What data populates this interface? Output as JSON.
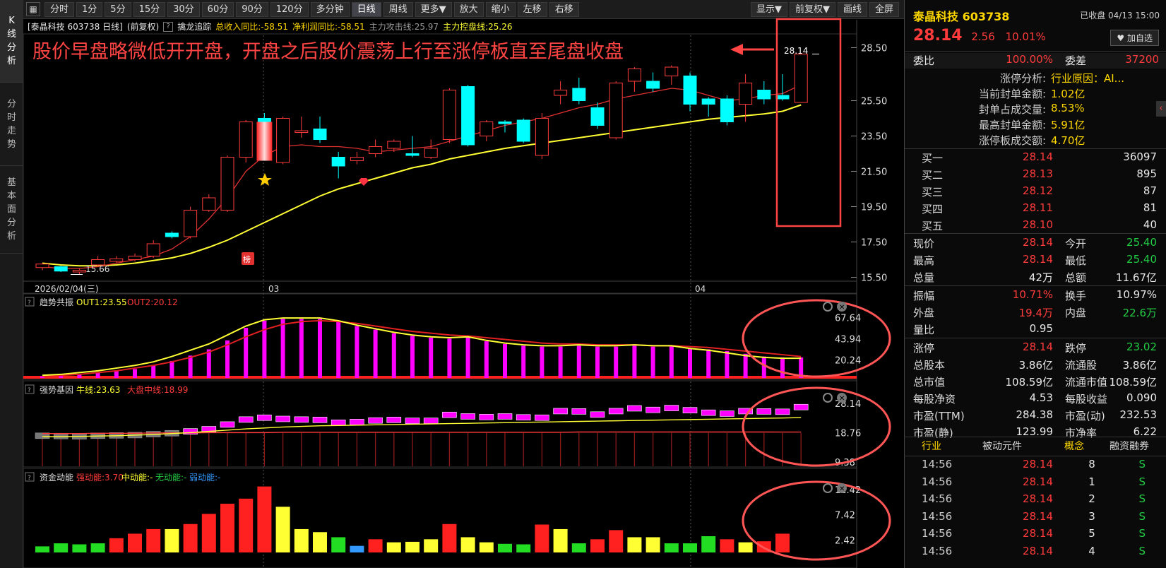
{
  "tabs": {
    "kline": [
      "K",
      "线",
      "分",
      "析"
    ],
    "timeshare": [
      "分",
      "时",
      "走",
      "势"
    ],
    "fundamental": [
      "基",
      "本",
      "面",
      "分",
      "析"
    ]
  },
  "toolbar": {
    "periods": [
      "分时",
      "1分",
      "5分",
      "15分",
      "30分",
      "60分",
      "90分",
      "120分",
      "多分钟",
      "日线",
      "周线",
      "更多▼",
      "放大",
      "缩小",
      "左移",
      "右移"
    ],
    "active_period": "日线",
    "right": [
      "显示▼",
      "前复权▼",
      "画线",
      "全屏"
    ]
  },
  "chart_info": {
    "stock": "[泰晶科技 603738 日线]",
    "adjust": "(前复权)",
    "indicator": "擒龙追踪",
    "revenue": "总收入同比:-58.51",
    "profit": "净利润同比:-58.51",
    "attack": "主力攻击线:25.97",
    "control": "主力控盘线:25.26"
  },
  "annotation": "股价早盘略微低开开盘，开盘之后股价震荡上行至涨停板直至尾盘收盘",
  "price_axis": [
    "28.50",
    "25.50",
    "23.50",
    "21.50",
    "19.50",
    "17.50",
    "15.50"
  ],
  "date_axis": {
    "start": "2026/02/04(三)",
    "m1": "03",
    "m2": "04"
  },
  "labels": {
    "low": "15.66",
    "last": "28.14",
    "bang": "榜"
  },
  "panel1": {
    "name": "趋势共振",
    "out1": "OUT1:23.55",
    "out2": "OUT2:20.12",
    "axis": [
      "67.64",
      "43.94",
      "20.24"
    ]
  },
  "panel2": {
    "name": "强势基因",
    "bull": "牛线:23.63",
    "market": "大盘中线:18.99",
    "axis": [
      "28.14",
      "18.76",
      "9.38"
    ]
  },
  "panel3": {
    "name": "资金动能",
    "strong": "强动能:3.70",
    "mid": "中动能:-",
    "none": "无动能:-",
    "weak": "弱动能:-",
    "axis": [
      "12.42",
      "7.42",
      "2.42"
    ]
  },
  "colors": {
    "up": "#ff3b3b",
    "down": "#00ffff",
    "ma_yellow": "#ffff33",
    "magenta": "#ff00ff",
    "annotation": "#ff4444"
  },
  "chart_data": {
    "type": "candlestick",
    "ylim": [
      15.2,
      29.2
    ],
    "candles": [
      [
        16.05,
        16.25,
        15.9,
        16.3
      ],
      [
        16.1,
        15.85,
        15.8,
        16.15
      ],
      [
        15.8,
        15.9,
        15.66,
        16.0
      ],
      [
        16.2,
        16.5,
        16.1,
        16.7
      ],
      [
        16.4,
        16.55,
        16.3,
        16.7
      ],
      [
        16.5,
        16.7,
        16.4,
        16.85
      ],
      [
        16.7,
        17.4,
        16.6,
        17.6
      ],
      [
        18.0,
        17.8,
        17.7,
        18.1
      ],
      [
        17.8,
        19.3,
        17.7,
        19.5
      ],
      [
        19.3,
        20.0,
        19.2,
        20.2
      ],
      [
        19.3,
        22.3,
        19.2,
        22.4
      ],
      [
        22.3,
        24.3,
        22.0,
        24.4
      ],
      [
        24.5,
        23.2,
        22.9,
        24.8
      ],
      [
        22.0,
        24.5,
        21.9,
        24.6
      ],
      [
        23.7,
        23.8,
        23.4,
        24.6
      ],
      [
        23.9,
        23.3,
        23.1,
        24.6
      ],
      [
        22.3,
        21.8,
        21.1,
        22.6
      ],
      [
        22.1,
        22.3,
        21.9,
        22.6
      ],
      [
        22.5,
        22.9,
        22.3,
        23.3
      ],
      [
        22.8,
        23.2,
        22.6,
        23.3
      ],
      [
        22.5,
        22.4,
        22.3,
        23.5
      ],
      [
        22.3,
        22.8,
        22.2,
        23.3
      ],
      [
        23.3,
        26.1,
        23.1,
        26.2
      ],
      [
        26.3,
        23.0,
        22.9,
        26.4
      ],
      [
        23.5,
        24.3,
        23.2,
        24.4
      ],
      [
        24.3,
        24.2,
        23.7,
        24.4
      ],
      [
        24.4,
        23.2,
        23.1,
        24.5
      ],
      [
        22.4,
        24.5,
        22.2,
        24.8
      ],
      [
        25.8,
        26.1,
        25.3,
        26.6
      ],
      [
        26.2,
        25.5,
        25.3,
        26.8
      ],
      [
        25.1,
        24.1,
        23.9,
        25.4
      ],
      [
        23.4,
        26.5,
        23.3,
        26.6
      ],
      [
        26.6,
        27.3,
        26.0,
        27.4
      ],
      [
        26.6,
        26.2,
        26.0,
        27.1
      ],
      [
        26.9,
        27.4,
        26.4,
        27.5
      ],
      [
        26.9,
        25.3,
        24.9,
        27.1
      ],
      [
        25.6,
        25.3,
        24.6,
        25.7
      ],
      [
        25.6,
        24.3,
        24.1,
        25.8
      ],
      [
        25.3,
        26.5,
        24.3,
        27.0
      ],
      [
        26.1,
        25.6,
        25.3,
        26.6
      ],
      [
        25.8,
        25.6,
        25.5,
        27.0
      ],
      [
        25.4,
        28.14,
        25.4,
        28.14
      ]
    ],
    "ma1": [
      16.1,
      16.0,
      16.0,
      16.1,
      16.3,
      16.5,
      16.7,
      17.1,
      17.8,
      18.8,
      20.0,
      21.5,
      22.4,
      22.9,
      23.0,
      22.9,
      22.9,
      22.8,
      22.6,
      22.7,
      22.8,
      22.9,
      23.2,
      23.5,
      23.8,
      24.1,
      24.3,
      24.5,
      24.8,
      25.1,
      25.3,
      25.6,
      25.8,
      26.0,
      26.2,
      26.1,
      25.8,
      25.5,
      25.6,
      25.8,
      25.9,
      26.4
    ],
    "ma2": [
      16.3,
      16.2,
      16.15,
      16.15,
      16.2,
      16.3,
      16.45,
      16.6,
      16.85,
      17.2,
      17.6,
      18.1,
      18.6,
      19.1,
      19.6,
      20.1,
      20.5,
      20.8,
      21.1,
      21.4,
      21.7,
      21.9,
      22.2,
      22.4,
      22.6,
      22.8,
      22.95,
      23.1,
      23.25,
      23.4,
      23.55,
      23.7,
      23.85,
      24.0,
      24.15,
      24.3,
      24.45,
      24.55,
      24.65,
      24.75,
      24.9,
      25.26
    ],
    "trend_bars": [
      2,
      3,
      4,
      6,
      8,
      10,
      14,
      19,
      25,
      32,
      42,
      56,
      64,
      66,
      66,
      66,
      63,
      58,
      54,
      50,
      47,
      45,
      44,
      46,
      41,
      38,
      36,
      35,
      35,
      36,
      35,
      35,
      36,
      35,
      36,
      33,
      32,
      30,
      27,
      24,
      23,
      23,
      27
    ],
    "trend_out1": [
      3,
      4,
      6,
      8,
      11,
      14,
      18,
      24,
      31,
      38,
      48,
      58,
      65,
      67,
      67,
      67,
      64,
      59,
      55,
      51,
      48,
      46,
      45,
      46,
      42,
      39,
      37,
      36,
      36,
      37,
      36,
      36,
      37,
      36,
      36,
      33,
      31,
      28,
      25,
      23,
      22,
      22,
      23.55
    ],
    "trend_out2": [
      2,
      3,
      4,
      6,
      8,
      11,
      14,
      18,
      23,
      29,
      37,
      46,
      54,
      60,
      63,
      64,
      63,
      61,
      58,
      55,
      52,
      50,
      48,
      47,
      45,
      43,
      41,
      39,
      38,
      38,
      37,
      37,
      37,
      36,
      36,
      35,
      34,
      32,
      30,
      28,
      26,
      24,
      20.12
    ],
    "gene_boxes": [
      17.8,
      17.7,
      17.6,
      17.8,
      17.9,
      18.0,
      18.3,
      18.6,
      19.2,
      19.9,
      21.4,
      23.0,
      23.6,
      23.2,
      23.0,
      22.9,
      22.0,
      22.2,
      22.7,
      22.9,
      22.6,
      22.6,
      24.5,
      24.0,
      23.8,
      24.0,
      23.7,
      23.6,
      25.7,
      25.6,
      24.6,
      25.7,
      26.6,
      26.1,
      26.7,
      26.0,
      25.2,
      24.9,
      25.7,
      25.6,
      25.5,
      27.0
    ],
    "gene_bull": [
      17.5,
      17.5,
      17.6,
      17.7,
      17.8,
      18.0,
      18.2,
      18.5,
      18.8,
      19.2,
      19.6,
      20.0,
      20.3,
      20.6,
      20.8,
      21.0,
      21.1,
      21.2,
      21.3,
      21.4,
      21.5,
      21.6,
      21.7,
      21.8,
      21.9,
      22.0,
      22.1,
      22.2,
      22.3,
      22.4,
      22.5,
      22.6,
      22.7,
      22.8,
      22.9,
      23.0,
      23.1,
      23.2,
      23.3,
      23.4,
      23.5,
      23.63
    ],
    "gene_market": [
      18.5,
      18.5,
      18.5,
      18.6,
      18.6,
      18.6,
      18.7,
      18.7,
      18.7,
      18.8,
      18.8,
      18.8,
      18.8,
      18.9,
      18.9,
      18.9,
      18.9,
      18.9,
      18.9,
      18.9,
      18.9,
      18.9,
      18.9,
      18.9,
      18.9,
      18.9,
      18.9,
      18.9,
      18.9,
      19.0,
      19.0,
      19.0,
      19.0,
      19.0,
      19.0,
      19.0,
      19.0,
      19.0,
      19.0,
      19.0,
      18.99,
      18.99
    ],
    "fund_bars": [
      [
        1.2,
        "g"
      ],
      [
        1.8,
        "g"
      ],
      [
        1.6,
        "g"
      ],
      [
        1.8,
        "g"
      ],
      [
        2.8,
        "r"
      ],
      [
        3.7,
        "r"
      ],
      [
        4.6,
        "r"
      ],
      [
        4.6,
        "y"
      ],
      [
        5.6,
        "r"
      ],
      [
        7.6,
        "r"
      ],
      [
        9.6,
        "r"
      ],
      [
        10.6,
        "r"
      ],
      [
        13.0,
        "r"
      ],
      [
        9.0,
        "y"
      ],
      [
        4.6,
        "y"
      ],
      [
        4.0,
        "y"
      ],
      [
        3.0,
        "g"
      ],
      [
        1.3,
        "b"
      ],
      [
        2.6,
        "r"
      ],
      [
        2.0,
        "y"
      ],
      [
        2.1,
        "y"
      ],
      [
        2.6,
        "y"
      ],
      [
        5.6,
        "r"
      ],
      [
        3.0,
        "y"
      ],
      [
        2.0,
        "y"
      ],
      [
        1.7,
        "g"
      ],
      [
        1.6,
        "g"
      ],
      [
        5.5,
        "r"
      ],
      [
        4.6,
        "y"
      ],
      [
        1.8,
        "g"
      ],
      [
        2.6,
        "r"
      ],
      [
        4.4,
        "r"
      ],
      [
        3.0,
        "y"
      ],
      [
        3.0,
        "y"
      ],
      [
        1.8,
        "g"
      ],
      [
        1.8,
        "g"
      ],
      [
        3.2,
        "g"
      ],
      [
        2.6,
        "r"
      ],
      [
        2.0,
        "y"
      ],
      [
        2.2,
        "r"
      ],
      [
        3.7,
        "r"
      ]
    ]
  },
  "quote": {
    "name": "泰晶科技 603738",
    "status": "已收盘 04/13 15:00",
    "price": "28.14",
    "change": "2.56",
    "pct": "10.01%",
    "watch": "♥ 加自选",
    "webi_label": "委比",
    "webi_val": "100.00%",
    "weicha_label": "委差",
    "weicha_val": "37200",
    "limit": [
      {
        "k": "涨停分析:",
        "v": "行业原因：AI..."
      },
      {
        "k": "当前封单金额:",
        "v": "1.02亿"
      },
      {
        "k": "封单占成交量:",
        "v": "8.53%"
      },
      {
        "k": "最高封单金额:",
        "v": "5.91亿"
      },
      {
        "k": "涨停板成交额:",
        "v": "4.70亿"
      }
    ],
    "bids": [
      {
        "label": "买一",
        "price": "28.14",
        "vol": "36097"
      },
      {
        "label": "买二",
        "price": "28.13",
        "vol": "895"
      },
      {
        "label": "买三",
        "price": "28.12",
        "vol": "87"
      },
      {
        "label": "买四",
        "price": "28.11",
        "vol": "81"
      },
      {
        "label": "买五",
        "price": "28.10",
        "vol": "40"
      }
    ],
    "stats": [
      {
        "l1": "现价",
        "v1": "28.14",
        "c1": "red",
        "l2": "今开",
        "v2": "25.40",
        "c2": "green"
      },
      {
        "l1": "最高",
        "v1": "28.14",
        "c1": "red",
        "l2": "最低",
        "v2": "25.40",
        "c2": "green"
      },
      {
        "l1": "总量",
        "v1": "42万",
        "c1": "white",
        "l2": "总额",
        "v2": "11.67亿",
        "c2": "white"
      },
      {
        "l1": "振幅",
        "v1": "10.71%",
        "c1": "red",
        "l2": "换手",
        "v2": "10.97%",
        "c2": "white"
      },
      {
        "l1": "外盘",
        "v1": "19.4万",
        "c1": "red",
        "l2": "内盘",
        "v2": "22.6万",
        "c2": "green"
      },
      {
        "l1": "量比",
        "v1": "0.95",
        "c1": "white",
        "l2": "",
        "v2": "",
        "c2": "white"
      },
      {
        "l1": "涨停",
        "v1": "28.14",
        "c1": "red",
        "l2": "跌停",
        "v2": "23.02",
        "c2": "green"
      },
      {
        "l1": "总股本",
        "v1": "3.86亿",
        "c1": "white",
        "l2": "流通股",
        "v2": "3.86亿",
        "c2": "white"
      },
      {
        "l1": "总市值",
        "v1": "108.59亿",
        "c1": "white",
        "l2": "流通市值",
        "v2": "108.59亿",
        "c2": "white"
      },
      {
        "l1": "每股净资",
        "v1": "4.53",
        "c1": "white",
        "l2": "每股收益",
        "v2": "0.090",
        "c2": "white"
      },
      {
        "l1": "市盈(TTM)",
        "v1": "284.38",
        "c1": "white",
        "l2": "市盈(动)",
        "v2": "232.53",
        "c2": "white"
      },
      {
        "l1": "市盈(静)",
        "v1": "123.99",
        "c1": "white",
        "l2": "市净率",
        "v2": "6.22",
        "c2": "white"
      }
    ],
    "tags": [
      "行业",
      "被动元件",
      "概念",
      "融资融券"
    ],
    "ticks": [
      {
        "time": "14:56",
        "price": "28.14",
        "vol": "8",
        "side": "S"
      },
      {
        "time": "14:56",
        "price": "28.14",
        "vol": "1",
        "side": "S"
      },
      {
        "time": "14:56",
        "price": "28.14",
        "vol": "2",
        "side": "S"
      },
      {
        "time": "14:56",
        "price": "28.14",
        "vol": "3",
        "side": "S"
      },
      {
        "time": "14:56",
        "price": "28.14",
        "vol": "5",
        "side": "S"
      },
      {
        "time": "14:56",
        "price": "28.14",
        "vol": "4",
        "side": "S"
      }
    ]
  }
}
